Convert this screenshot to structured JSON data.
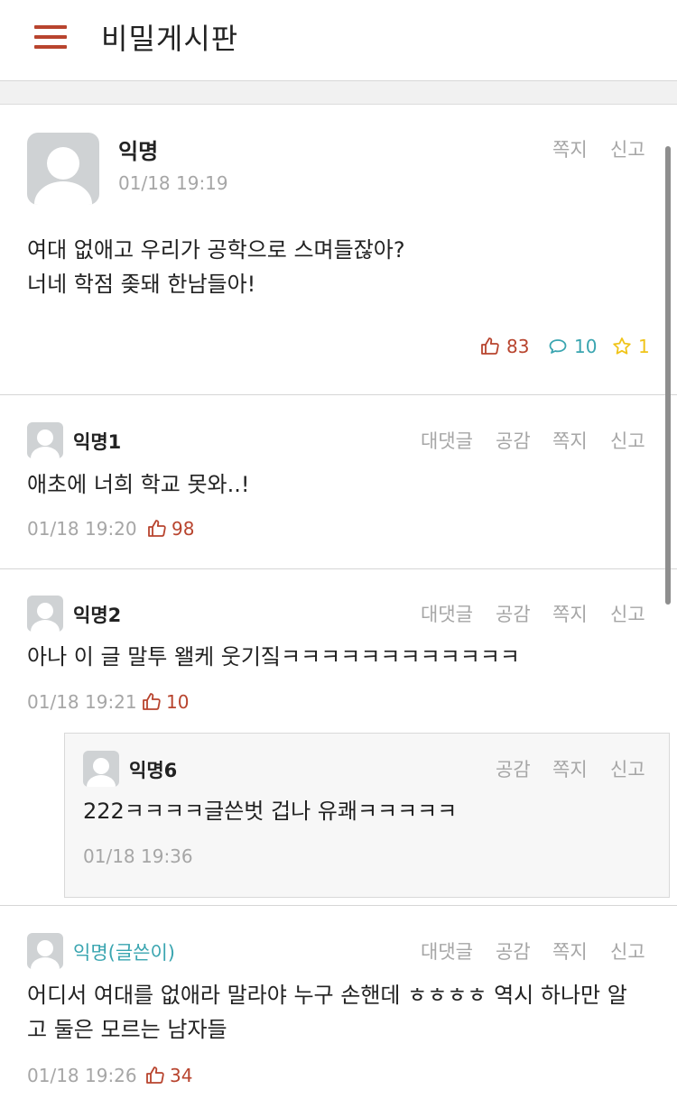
{
  "header": {
    "title": "비밀게시판",
    "menu_icon": "hamburger-menu-icon"
  },
  "post": {
    "author": "익명",
    "time": "01/18 19:19",
    "actions": {
      "message": "쪽지",
      "report": "신고"
    },
    "body_lines": [
      "여대 없애고 우리가 공학으로 스며들잖아?",
      "너네 학점 좆돼 한남들아!"
    ],
    "stats": {
      "likes": "83",
      "comments": "10",
      "scraps": "1"
    }
  },
  "comment_actions": {
    "reply": "대댓글",
    "like": "공감",
    "message": "쪽지",
    "report": "신고"
  },
  "comments": [
    {
      "author": "익명1",
      "text": "애초에 너희 학교 못와..!",
      "time": "01/18 19:20",
      "likes": "98"
    },
    {
      "author": "익명2",
      "text": "아나 이 글 말투 왤케 웃기짘ㅋㅋㅋㅋㅋㅋㅋㅋㅋㅋㅋㅋ",
      "time": "01/18 19:21",
      "likes": "10",
      "reply": {
        "author": "익명6",
        "text": "222ㅋㅋㅋㅋ글쓴벗 겁나 유쾌ㅋㅋㅋㅋㅋ",
        "time": "01/18 19:36"
      }
    },
    {
      "author": "익명(글쓴이)",
      "text_lines": [
        "어디서 여대를 없애라 말라야 누구 손핸데 ㅎㅎㅎㅎ 역시 하나만 알",
        "고 둘은 모르는 남자들"
      ],
      "time": "01/18 19:26",
      "likes": "34"
    }
  ],
  "colors": {
    "accent": "#b8442e",
    "comment_blue": "#3aa5b0",
    "scrap_yellow": "#f0c419",
    "meta_gray": "#a6a6a6"
  }
}
